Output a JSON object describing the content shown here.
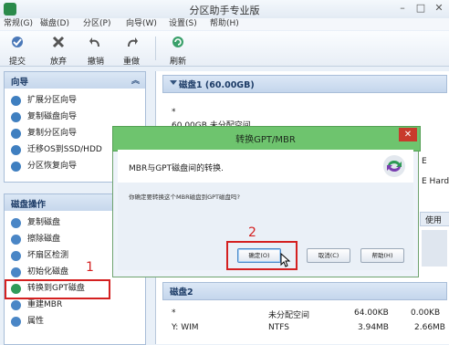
{
  "app": {
    "title": "分区助手专业版"
  },
  "menu": [
    "常规(G)",
    "磁盘(D)",
    "分区(P)",
    "向导(W)",
    "设置(S)",
    "帮助(H)"
  ],
  "toolbar": {
    "submit": "提交",
    "discard": "放弃",
    "undo": "撤销",
    "redo": "重做",
    "refresh": "刷新"
  },
  "wizard_panel": {
    "title": "向导",
    "items": [
      "扩展分区向导",
      "复制磁盘向导",
      "复制分区向导",
      "迁移OS到SSD/HDD",
      "分区恢复向导"
    ]
  },
  "disk_ops_panel": {
    "title": "磁盘操作",
    "items": [
      "复制磁盘",
      "擦除磁盘",
      "坏扇区检测",
      "初始化磁盘",
      "转换到GPT磁盘",
      "重建MBR",
      "属性"
    ]
  },
  "disk1": {
    "title": "磁盘1 (60.00GB)",
    "star": "*",
    "unalloc": "60.00GB 未分配空间",
    "right_e": "E",
    "right_ehard": "E Hard",
    "right_use": "使用"
  },
  "disk2": {
    "title": "磁盘2",
    "rows": [
      {
        "name": "*",
        "fs": "未分配空间",
        "capacity": "64.00KB",
        "used": "0.00KB"
      },
      {
        "name": "Y: WIM",
        "fs": "NTFS",
        "capacity": "3.94MB",
        "used": "2.66MB"
      }
    ]
  },
  "dialog": {
    "title": "转换GPT/MBR",
    "close": "✕",
    "description": "MBR与GPT磁盘间的转换.",
    "question": "你确定要转换这个MBR磁盘到GPT磁盘吗?",
    "ok": "确定(O)",
    "cancel": "取消(C)",
    "help": "帮助(H)"
  },
  "annotations": {
    "step1": "1",
    "step2": "2"
  },
  "colors": {
    "dialog_title_bar": "#6ec46e",
    "highlight": "#d42020",
    "close": "#c83a2c"
  }
}
